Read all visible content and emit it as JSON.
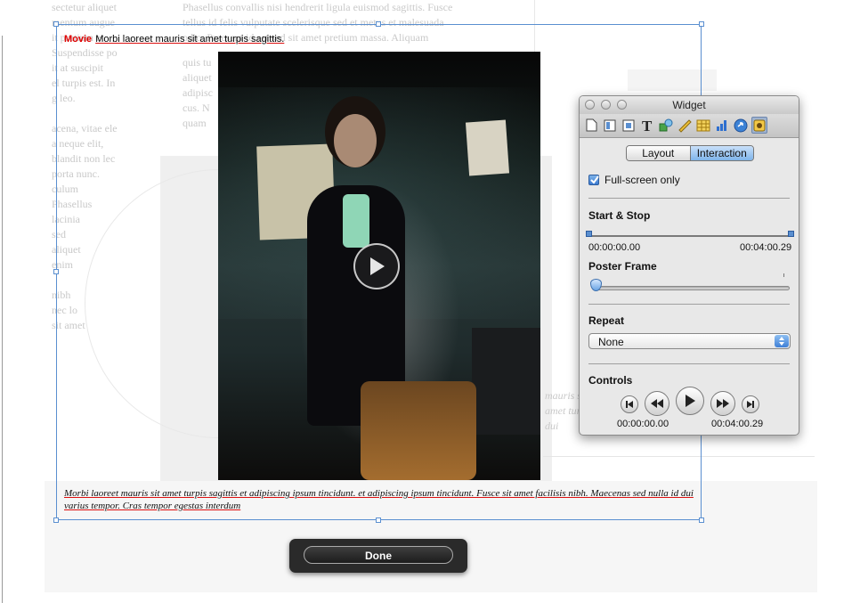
{
  "background": {
    "left_column": [
      "sectetur aliquet",
      "mentum augue",
      "it pretium et",
      "Suspendisse po",
      "it at suscipit",
      "el turpis est. In",
      "g leo.",
      "",
      "acena, vitae ele",
      "a neque elit,",
      "blandit non lec",
      "porta nunc.",
      "culum",
      "Phasellus",
      "lacinia",
      "sed",
      "aliquet",
      "enim",
      "",
      "nibh",
      "nec lo",
      "sit amet"
    ],
    "top_text": [
      "Phasellus convallis nisi hendrerit ligula euismod sagittis. Fusce",
      "tellus id felis vulputate scelerisque sed et metus et malesuada",
      "odio. Praesent id est sed sit amet pretium massa. Aliquam"
    ],
    "mid_text": [
      "quis tu",
      "aliquet",
      "adipisc",
      "cus. N",
      "quam"
    ],
    "right_text": [
      "mauris sit",
      "amet turpis sagittis et adipiscing ipsum tincidunt.",
      "dui"
    ]
  },
  "movie": {
    "label": "Movie",
    "title": "Morbi laoreet mauris sit amet turpis sagittis."
  },
  "caption": "Morbi laoreet mauris sit amet turpis sagittis et adipiscing ipsum tincidunt. et adipiscing ipsum tincidunt. Fusce sit amet facilisis nibh. Maecenas sed nulla id dui varius tempor. Cras tempor egestas interdum",
  "done_label": "Done",
  "widget": {
    "title": "Widget",
    "tabs": {
      "layout": "Layout",
      "interaction": "Interaction"
    },
    "fullscreen_label": "Full-screen only",
    "fullscreen_checked": true,
    "start_stop_title": "Start & Stop",
    "start_time": "00:00:00.00",
    "stop_time": "00:04:00.29",
    "poster_frame_title": "Poster Frame",
    "repeat_title": "Repeat",
    "repeat_value": "None",
    "controls_title": "Controls",
    "controls_start": "00:00:00.00",
    "controls_end": "00:04:00.29"
  },
  "colors": {
    "selection": "#5a8fd0",
    "movie_label": "#e00000",
    "accent_blue": "#3e7fd6"
  }
}
